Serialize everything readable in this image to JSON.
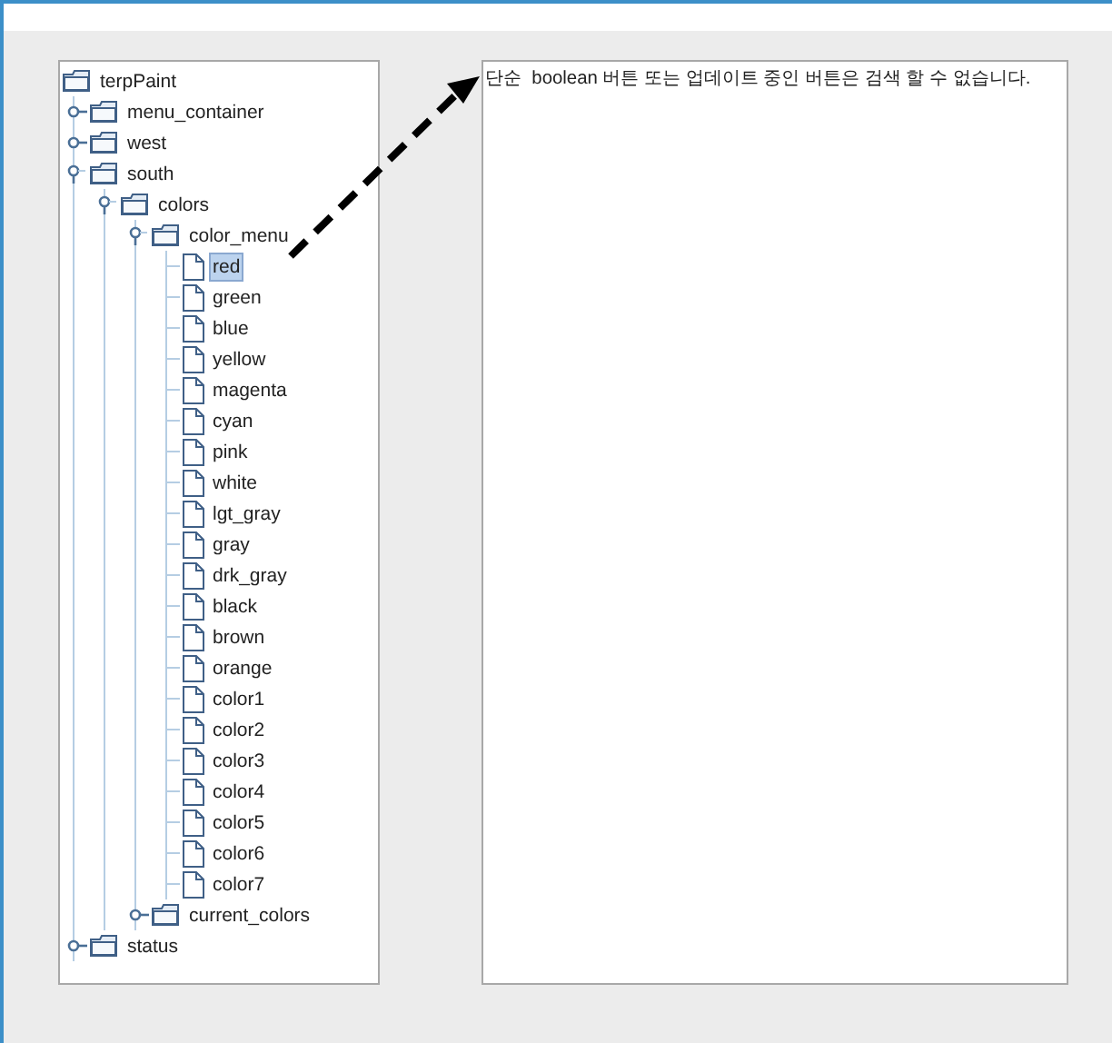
{
  "tree": {
    "label": "terpPaint",
    "kind": "folder",
    "selected": false,
    "children": [
      {
        "label": "menu_container",
        "kind": "folder",
        "expanded": false,
        "selected": false
      },
      {
        "label": "west",
        "kind": "folder",
        "expanded": false,
        "selected": false
      },
      {
        "label": "south",
        "kind": "folder",
        "expanded": true,
        "selected": false,
        "children": [
          {
            "label": "colors",
            "kind": "folder",
            "expanded": true,
            "selected": false,
            "children": [
              {
                "label": "color_menu",
                "kind": "folder",
                "expanded": true,
                "selected": false,
                "children": [
                  {
                    "label": "red",
                    "kind": "file",
                    "selected": true
                  },
                  {
                    "label": "green",
                    "kind": "file",
                    "selected": false
                  },
                  {
                    "label": "blue",
                    "kind": "file",
                    "selected": false
                  },
                  {
                    "label": "yellow",
                    "kind": "file",
                    "selected": false
                  },
                  {
                    "label": "magenta",
                    "kind": "file",
                    "selected": false
                  },
                  {
                    "label": "cyan",
                    "kind": "file",
                    "selected": false
                  },
                  {
                    "label": "pink",
                    "kind": "file",
                    "selected": false
                  },
                  {
                    "label": "white",
                    "kind": "file",
                    "selected": false
                  },
                  {
                    "label": "lgt_gray",
                    "kind": "file",
                    "selected": false
                  },
                  {
                    "label": "gray",
                    "kind": "file",
                    "selected": false
                  },
                  {
                    "label": "drk_gray",
                    "kind": "file",
                    "selected": false
                  },
                  {
                    "label": "black",
                    "kind": "file",
                    "selected": false
                  },
                  {
                    "label": "brown",
                    "kind": "file",
                    "selected": false
                  },
                  {
                    "label": "orange",
                    "kind": "file",
                    "selected": false
                  },
                  {
                    "label": "color1",
                    "kind": "file",
                    "selected": false
                  },
                  {
                    "label": "color2",
                    "kind": "file",
                    "selected": false
                  },
                  {
                    "label": "color3",
                    "kind": "file",
                    "selected": false
                  },
                  {
                    "label": "color4",
                    "kind": "file",
                    "selected": false
                  },
                  {
                    "label": "color5",
                    "kind": "file",
                    "selected": false
                  },
                  {
                    "label": "color6",
                    "kind": "file",
                    "selected": false
                  },
                  {
                    "label": "color7",
                    "kind": "file",
                    "selected": false
                  }
                ]
              },
              {
                "label": "current_colors",
                "kind": "folder",
                "expanded": false,
                "selected": false
              }
            ]
          }
        ]
      },
      {
        "label": "status",
        "kind": "folder",
        "expanded": false,
        "selected": false
      }
    ]
  },
  "text_panel": {
    "text": "단순  boolean 버튼 또는 업데이트 중인 버튼은 검색 할 수 없습니다."
  }
}
